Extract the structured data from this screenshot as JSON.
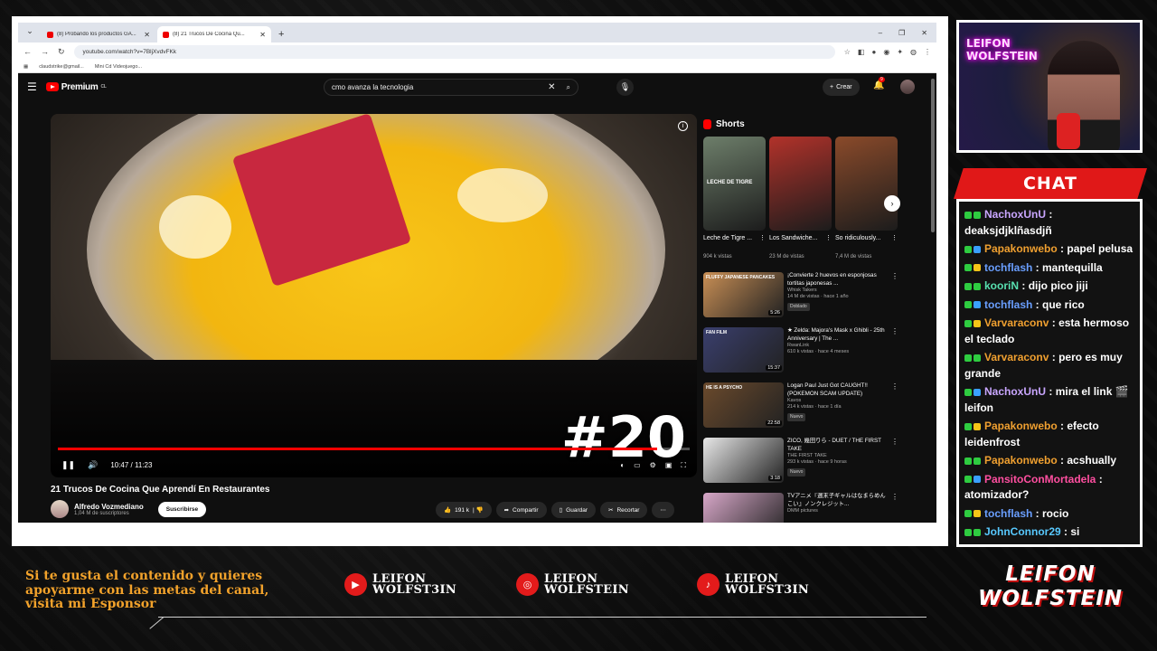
{
  "browser": {
    "tabs": [
      {
        "title": "(8) Probando los productos GA...",
        "active": false
      },
      {
        "title": "(8) 21 Trucos De Cocina Qu...",
        "active": true
      }
    ],
    "url": "youtube.com/watch?v=7BljXvdvFKk",
    "bookmarks": [
      "claudstrike@gmail...",
      "Mini Cd Videojuego..."
    ],
    "window_controls": [
      "–",
      "❐",
      "✕"
    ]
  },
  "youtube": {
    "logo": "Premium",
    "logo_region": "CL",
    "search_query": "cmo avanza la tecnologia",
    "create_label": "Crear",
    "notif_count": "9",
    "video": {
      "overlay_text": "#20",
      "time": "10:47 / 11:23",
      "progress": 0.948,
      "title": "21 Trucos De Cocina Que Aprendí En Restaurantes",
      "channel": "Alfredo Vozmediano",
      "subscribers": "1,04 M de suscriptores",
      "subscribe_label": "Suscribirse",
      "likes": "191 k",
      "share": "Compartir",
      "save": "Guardar",
      "clip": "Recortar"
    },
    "shorts_header": "Shorts",
    "shorts": [
      {
        "title": "Leche de Tigre ...",
        "views": "904 k vistas",
        "caption": "LECHE DE TIGRE",
        "color": "#6d7e6a"
      },
      {
        "title": "Los Sandwiche...",
        "views": "23 M de vistas",
        "caption": "",
        "color": "#b2322a"
      },
      {
        "title": "So ridiculously...",
        "views": "7,4 M de vistas",
        "caption": "",
        "color": "#8a4a2a"
      }
    ],
    "recommendations": [
      {
        "title": "¡Convierte 2 huevos en esponjosas tortitas japonesas ...",
        "channel": "Whisk Takers",
        "views": "14 M de vistas · hace 1 año",
        "badge": "Doblado",
        "duration": "5:26",
        "thumb_text": "FLUFFY JAPANESE PANCAKES",
        "color": "#c98f55"
      },
      {
        "title": "★ Zelda: Majora's Mask x Ghibli - 25th Anniversary | The ...",
        "channel": "RwanLink",
        "views": "610 k vistas · hace 4 meses",
        "badge": "",
        "duration": "15:37",
        "thumb_text": "FAN FILM",
        "color": "#3a3f6e"
      },
      {
        "title": "Logan Paul Just Got CAUGHT!! (POKEMON SCAM UPDATE)",
        "channel": "Kavos",
        "views": "214 k vistas · hace 1 día",
        "badge": "Nuevo",
        "duration": "22:58",
        "thumb_text": "HE IS A PSYCHO",
        "color": "#6b4a2c"
      },
      {
        "title": "ZICO, 幾田りら - DUET / THE FIRST TAKE",
        "channel": "THE FIRST TAKE",
        "views": "293 k vistas · hace 9 horas",
        "badge": "Nuevo",
        "duration": "3:18",
        "thumb_text": "",
        "color": "#e8e8e8"
      },
      {
        "title": "TVアニメ『週末子ギャルはなまらめんこい』ノンクレジット...",
        "channel": "DMM pictures",
        "views": "",
        "badge": "",
        "duration": "",
        "thumb_text": "",
        "color": "#d7a7c8"
      }
    ]
  },
  "cam_text": [
    "LEIFON",
    "WOLFSTEIN"
  ],
  "chat": {
    "header": "CHAT",
    "messages": [
      {
        "user": "NachoxUnU",
        "color": "#c9a6ff",
        "text": "deaksjdjklñasdjñ"
      },
      {
        "user": "Papakonwebo",
        "color": "#f0a030",
        "text": "papel pelusa"
      },
      {
        "user": "tochflash",
        "color": "#6a9fff",
        "text": "mantequilla"
      },
      {
        "user": "kooriN",
        "color": "#58e0b0",
        "text": "dijo pico jiji"
      },
      {
        "user": "tochflash",
        "color": "#6a9fff",
        "text": "que rico"
      },
      {
        "user": "Varvaraconv",
        "color": "#f0a030",
        "text": "esta hermoso el teclado"
      },
      {
        "user": "Varvaraconv",
        "color": "#f0a030",
        "text": "pero es muy grande"
      },
      {
        "user": "NachoxUnU",
        "color": "#c9a6ff",
        "text": "mira el link 🎬 leifon"
      },
      {
        "user": "Papakonwebo",
        "color": "#f0a030",
        "text": "efecto leidenfrost"
      },
      {
        "user": "Papakonwebo",
        "color": "#f0a030",
        "text": "acshually"
      },
      {
        "user": "PansitoConMortadela",
        "color": "#ff4fa0",
        "text": "atomizador?"
      },
      {
        "user": "tochflash",
        "color": "#6a9fff",
        "text": "rocio"
      },
      {
        "user": "JohnConnor29",
        "color": "#58c9ff",
        "text": "si"
      }
    ]
  },
  "footer": {
    "sponsor_text": "Si te gusta el contenido y quieres apoyarme con las metas del canal, visita mi Esponsor",
    "socials": [
      {
        "icon": "youtube-icon",
        "line1": "LEIFON",
        "line2": "WOLFST3IN"
      },
      {
        "icon": "instagram-icon",
        "line1": "LEIFON",
        "line2": "WOLFSTEIN"
      },
      {
        "icon": "tiktok-icon",
        "line1": "LEIFON",
        "line2": "WOLFST3IN"
      }
    ],
    "brand": [
      "LEIFON",
      "WOLFSTEIN"
    ]
  }
}
